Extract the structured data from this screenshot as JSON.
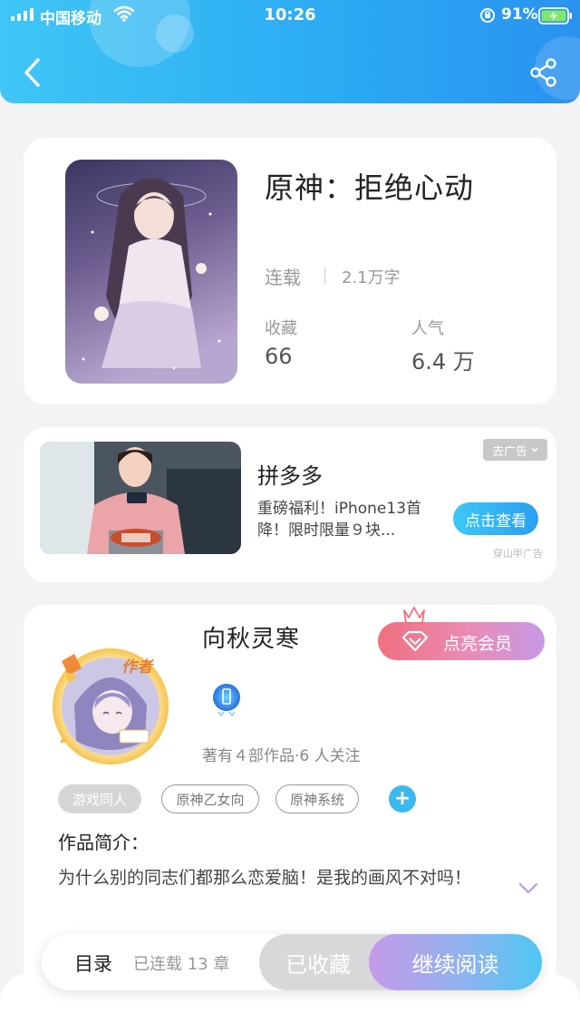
{
  "status_bar": {
    "carrier": "中国移动",
    "time": "10:26",
    "battery_percent": "91%"
  },
  "header": {
    "back_icon": "chevron-left-icon",
    "share_icon": "share-icon"
  },
  "book": {
    "title": "原神：拒绝心动",
    "status": "连载",
    "word_count": "2.1万字",
    "favorites_label": "收藏",
    "favorites_value": "66",
    "popularity_label": "人气",
    "popularity_value": "6.4 万"
  },
  "ad": {
    "brand": "拼多多",
    "text": "重磅福利！iPhone13首降！限时限量９块...",
    "cta": "点击查看",
    "close_label": "去广告",
    "source": "穿山甲广告"
  },
  "author": {
    "name": "向秋灵寒",
    "vip_label": "点亮会员",
    "meta": "著有４部作品·6 人关注",
    "avatar_badge": "作者",
    "tags": [
      "游戏同人",
      "原神乙女向",
      "原神系统"
    ],
    "intro_label": "作品简介：",
    "intro_text": "为什么别的同志们都那么恋爱脑！是我的画风不对吗！"
  },
  "bottom": {
    "toc": "目录",
    "chapters": "已连载 13 章",
    "favorited": "已收藏",
    "continue": "继续阅读"
  },
  "colors": {
    "header_gradient": [
      "#3fc6f5",
      "#2a92f0"
    ],
    "accent_blue": "#3bb8ef",
    "vip_gradient": [
      "#f0707e",
      "#c799e6"
    ],
    "read_gradient": [
      "#c59ae9",
      "#4fc6f3"
    ]
  }
}
